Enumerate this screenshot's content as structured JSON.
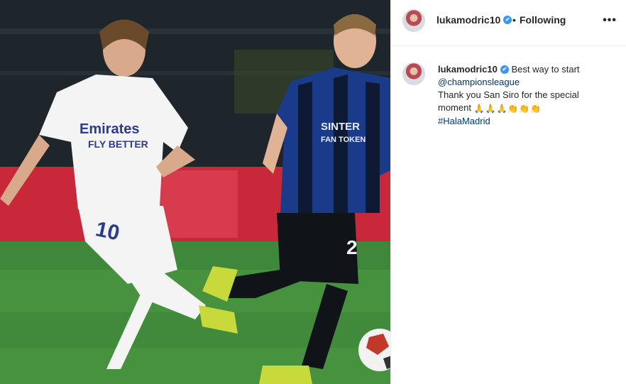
{
  "post": {
    "username": "lukamodric10",
    "verified_badge": "✔",
    "follow_separator": "•",
    "follow_status": "Following",
    "more_icon": "•••"
  },
  "caption": {
    "username": "lukamodric10",
    "text_line_1": "Best way to start",
    "mention": "@championsleague",
    "text_line_3": "Thank you San Siro for the special",
    "text_line_4": "moment",
    "emojis": "🙏🙏🙏👏👏👏",
    "hashtag": "#HalaMadrid"
  },
  "photo": {
    "left_player": {
      "sponsor_line_1": "Emirates",
      "sponsor_line_2": "FLY BETTER",
      "number": "10"
    },
    "right_player": {
      "sponsor_line_1": "SINTER",
      "sponsor_line_2": "FAN TOKEN",
      "number": "2"
    }
  },
  "colors": {
    "link": "#00376b",
    "verified": "#3897f0",
    "border": "#efefef"
  }
}
